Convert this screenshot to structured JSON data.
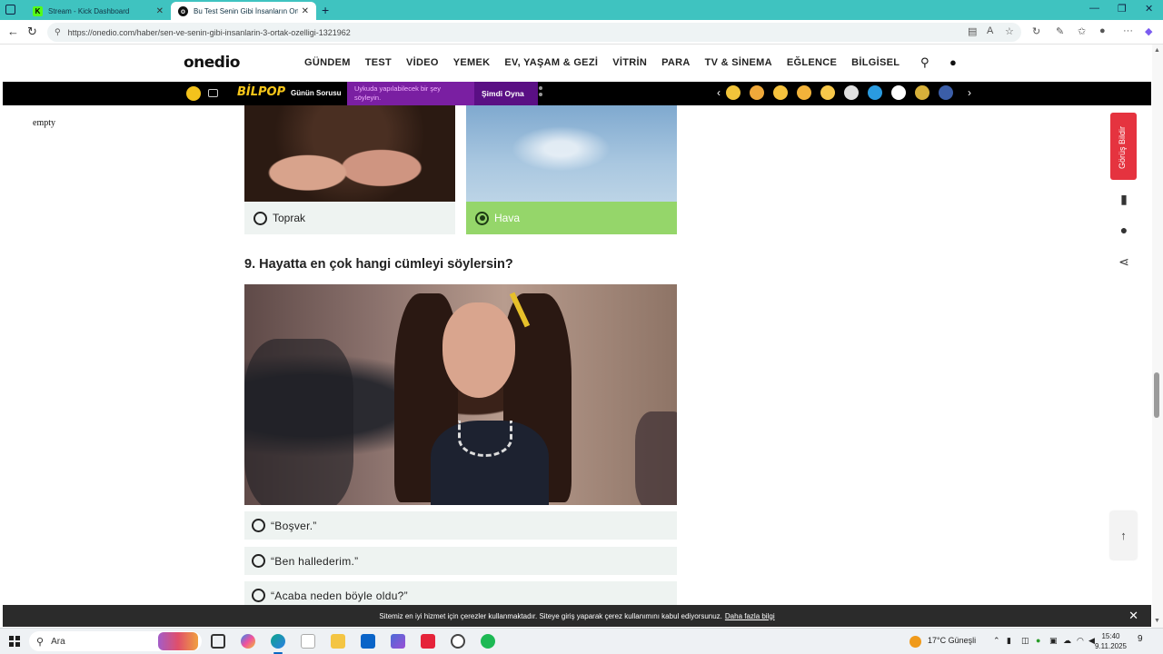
{
  "browser": {
    "tabs": [
      {
        "title": "Stream - Kick Dashboard",
        "active": false
      },
      {
        "title": "Bu Test Senin Gibi İnsanların Orta",
        "active": true
      }
    ],
    "url": "https://onedio.com/haber/sen-ve-senin-gibi-insanlarin-3-ortak-ozelligi-1321962"
  },
  "site": {
    "logo": "onedio",
    "nav": [
      "GÜNDEM",
      "TEST",
      "VİDEO",
      "YEMEK",
      "EV, YAŞAM & GEZİ",
      "VİTRİN",
      "PARA",
      "TV & SİNEMA",
      "EĞLENCE",
      "BİLGİSEL"
    ]
  },
  "bilpop_bar": {
    "brand": "BİLPOP",
    "gunun_sorusu": "Günün Sorusu",
    "question": "Uykuda yapılabilecek bir şey söyleyin.",
    "cta": "Şimdi Oyna"
  },
  "sidebar_text": "empty",
  "feedback_button": "Görüş Bildir",
  "quiz": {
    "prev_options": [
      {
        "label": "Toprak",
        "selected": false
      },
      {
        "label": "Hava",
        "selected": true
      }
    ],
    "question": "9. Hayatta en çok hangi cümleyi söylersin?",
    "answers": [
      "“Boşver.”",
      "“Ben hallederim.”",
      "“Acaba neden böyle oldu?”"
    ]
  },
  "cookie": {
    "text": "Sitemiz en iyi hizmet için çerezler kullanmaktadır. Siteye giriş yaparak çerez kullanımını kabul ediyorsunuz.",
    "link": "Daha fazla bilgi"
  },
  "taskbar": {
    "search_placeholder": "Ara",
    "weather": "17°C Güneşli",
    "time": "15:40",
    "date": "9.11.2025",
    "notifications": "9"
  },
  "colors": {
    "selected_option": "#95d66a",
    "option_bg": "#eef3f1",
    "bilpop_purple": "#7a1fa2",
    "feedback_red": "#e5333f"
  }
}
